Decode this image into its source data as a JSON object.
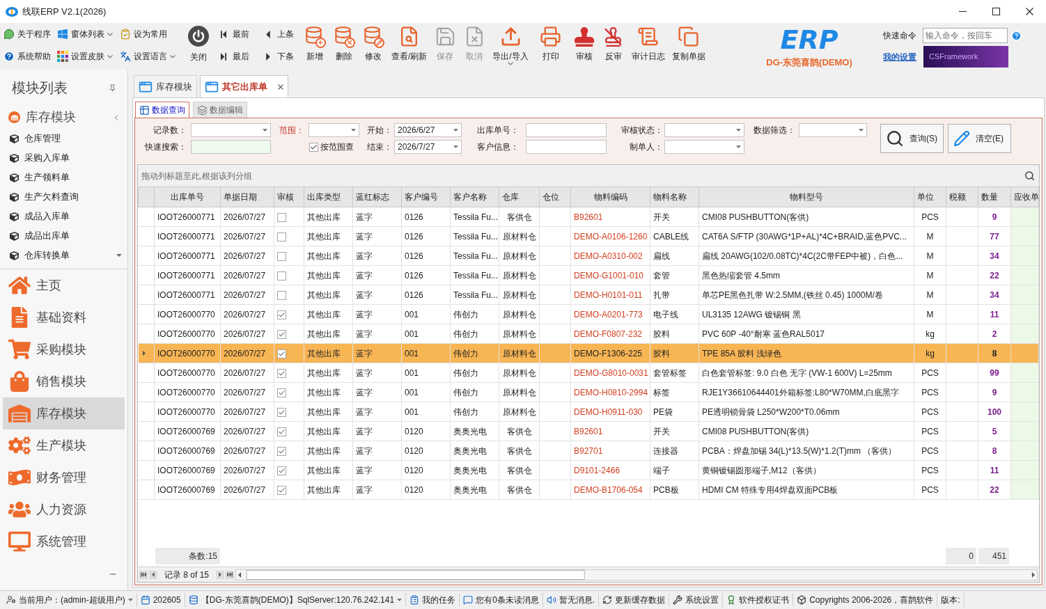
{
  "window": {
    "title": "线联ERP V2.1(2026)"
  },
  "ribbon": {
    "small_buttons": [
      {
        "label": "关于程序",
        "dropdown": false
      },
      {
        "label": "窗体列表",
        "dropdown": true
      },
      {
        "label": "设为常用",
        "dropdown": false
      },
      {
        "label": "系统帮助",
        "dropdown": false
      },
      {
        "label": "设置皮肤",
        "dropdown": true
      },
      {
        "label": "设置语言",
        "dropdown": true
      }
    ],
    "close_button": {
      "label": "关闭"
    },
    "nav_buttons": [
      {
        "label": "最前"
      },
      {
        "label": "上条"
      },
      {
        "label": "最后"
      },
      {
        "label": "下条"
      }
    ],
    "actions": [
      {
        "label": "新增",
        "disabled": false,
        "dropdown": false
      },
      {
        "label": "删除",
        "disabled": false,
        "dropdown": false
      },
      {
        "label": "修改",
        "disabled": false,
        "dropdown": false
      },
      {
        "label": "查看/刷新",
        "disabled": false,
        "dropdown": false
      },
      {
        "label": "保存",
        "disabled": true,
        "dropdown": false
      },
      {
        "label": "取消",
        "disabled": true,
        "dropdown": false
      },
      {
        "label": "导出/导入",
        "disabled": false,
        "dropdown": true
      },
      {
        "label": "打印",
        "disabled": false,
        "dropdown": false
      },
      {
        "label": "审核",
        "disabled": false,
        "dropdown": false
      },
      {
        "label": "反审",
        "disabled": false,
        "dropdown": false
      },
      {
        "label": "审计日志",
        "disabled": false,
        "dropdown": false
      },
      {
        "label": "复制单据",
        "disabled": false,
        "dropdown": false
      }
    ]
  },
  "brand": {
    "logo": "ERP",
    "company": "DG-东莞喜鹊(DEMO)"
  },
  "quick_command": {
    "label": "快速命令",
    "placeholder": "输入命令，按回车"
  },
  "settings_link": "我的设置",
  "banner": "CSFramework",
  "sidebar": {
    "title": "模块列表",
    "group": {
      "label": "库存模块",
      "expanded": true,
      "items": [
        "仓库管理",
        "采购入库单",
        "生产领料单",
        "生产欠料查询",
        "成品入库单",
        "成品出库单",
        "仓库转换单"
      ]
    },
    "modules": [
      {
        "label": "主页",
        "selected": false
      },
      {
        "label": "基础资料",
        "selected": false
      },
      {
        "label": "采购模块",
        "selected": false
      },
      {
        "label": "销售模块",
        "selected": false
      },
      {
        "label": "库存模块",
        "selected": true
      },
      {
        "label": "生产模块",
        "selected": false
      },
      {
        "label": "财务管理",
        "selected": false
      },
      {
        "label": "人力资源",
        "selected": false
      },
      {
        "label": "系统管理",
        "selected": false
      }
    ]
  },
  "doc_tabs": [
    {
      "label": "库存模块",
      "selected": false,
      "closable": false
    },
    {
      "label": "其它出库单",
      "selected": true,
      "closable": true
    }
  ],
  "inner_tabs": [
    {
      "label": "数据查询",
      "selected": true
    },
    {
      "label": "数据编辑",
      "selected": false
    }
  ],
  "filters": {
    "record_count": {
      "label": "记录数："
    },
    "quick_search": {
      "label": "快速搜索："
    },
    "range": {
      "label": "范围："
    },
    "range_check": {
      "label": "按范围查",
      "checked": true
    },
    "start": {
      "label": "开始：",
      "value": "2026/6/27"
    },
    "end": {
      "label": "结束：",
      "value": "2026/7/27"
    },
    "order_no": {
      "label": "出库单号："
    },
    "customer": {
      "label": "客户信息："
    },
    "audit_status": {
      "label": "审核状态："
    },
    "creator": {
      "label": "制单人："
    },
    "data_filter": {
      "label": "数据筛选："
    },
    "buttons": [
      "查询(S)",
      "清空(E)"
    ]
  },
  "grid": {
    "group_hint": "拖动列标题至此,根据该列分组",
    "columns": [
      "出库单号",
      "单据日期",
      "审核",
      "出库类型",
      "蓝红标志",
      "客户编号",
      "客户名称",
      "仓库",
      "仓位",
      "物料编码",
      "物料名称",
      "物料型号",
      "单位",
      "税额",
      "数量",
      "应收单"
    ],
    "rows": [
      {
        "selected": false,
        "order_no": "IOOT26000771",
        "date": "2026/07/27",
        "audited": false,
        "type": "其他出库",
        "flag": "蓝字",
        "customer_no": "0126",
        "customer_name": "Tessila Fu...",
        "warehouse": "客供仓",
        "material_code": "B92601",
        "material_name": "开关",
        "model": "CMI08 PUSHBUTTON(客供)",
        "unit": "PCS",
        "quantity": "9"
      },
      {
        "selected": false,
        "order_no": "IOOT26000771",
        "date": "2026/07/27",
        "audited": false,
        "type": "其他出库",
        "flag": "蓝字",
        "customer_no": "0126",
        "customer_name": "Tessila Fu...",
        "warehouse": "原材料仓",
        "material_code": "DEMO-A0106-1260",
        "material_name": "CABLE线",
        "model": "CAT6A S/FTP (30AWG*1P+AL)*4C+BRAID,蓝色PVC...",
        "unit": "M",
        "quantity": "77"
      },
      {
        "selected": false,
        "order_no": "IOOT26000771",
        "date": "2026/07/27",
        "audited": false,
        "type": "其他出库",
        "flag": "蓝字",
        "customer_no": "0126",
        "customer_name": "Tessila Fu...",
        "warehouse": "原材料仓",
        "material_code": "DEMO-A0310-002",
        "material_name": "扁线",
        "model": "扁线 20AWG(102/0.08TC)*4C(2C带FEP中被)，白色...",
        "unit": "M",
        "quantity": "34"
      },
      {
        "selected": false,
        "order_no": "IOOT26000771",
        "date": "2026/07/27",
        "audited": false,
        "type": "其他出库",
        "flag": "蓝字",
        "customer_no": "0126",
        "customer_name": "Tessila Fu...",
        "warehouse": "原材料仓",
        "material_code": "DEMO-G1001-010",
        "material_name": "套管",
        "model": "黑色热缩套管 4.5mm",
        "unit": "M",
        "quantity": "22"
      },
      {
        "selected": false,
        "order_no": "IOOT26000771",
        "date": "2026/07/27",
        "audited": false,
        "type": "其他出库",
        "flag": "蓝字",
        "customer_no": "0126",
        "customer_name": "Tessila Fu...",
        "warehouse": "原材料仓",
        "material_code": "DEMO-H0101-011",
        "material_name": "扎带",
        "model": "单芯PE黑色扎带 W:2.5MM,(铁丝 0.45) 1000M/卷",
        "unit": "M",
        "quantity": "34"
      },
      {
        "selected": false,
        "order_no": "IOOT26000770",
        "date": "2026/07/27",
        "audited": true,
        "type": "其他出库",
        "flag": "蓝字",
        "customer_no": "001",
        "customer_name": "伟创力",
        "warehouse": "原材料仓",
        "material_code": "DEMO-A0201-773",
        "material_name": "电子线",
        "model": "UL3135 12AWG 镀锡铜 黑",
        "unit": "M",
        "quantity": "11"
      },
      {
        "selected": false,
        "order_no": "IOOT26000770",
        "date": "2026/07/27",
        "audited": true,
        "type": "其他出库",
        "flag": "蓝字",
        "customer_no": "001",
        "customer_name": "伟创力",
        "warehouse": "原材料仓",
        "material_code": "DEMO-F0807-232",
        "material_name": "胶料",
        "model": "PVC 60P -40°耐寒 蓝色RAL5017",
        "unit": "kg",
        "quantity": "2"
      },
      {
        "selected": true,
        "order_no": "IOOT26000770",
        "date": "2026/07/27",
        "audited": true,
        "type": "其他出库",
        "flag": "蓝字",
        "customer_no": "001",
        "customer_name": "伟创力",
        "warehouse": "原材料仓",
        "material_code": "DEMO-F1306-225",
        "material_name": "胶料",
        "model": "TPE 85A 胶料 浅绿色",
        "unit": "kg",
        "quantity": "8"
      },
      {
        "selected": false,
        "order_no": "IOOT26000770",
        "date": "2026/07/27",
        "audited": true,
        "type": "其他出库",
        "flag": "蓝字",
        "customer_no": "001",
        "customer_name": "伟创力",
        "warehouse": "原材料仓",
        "material_code": "DEMO-G8010-0031",
        "material_name": "套管标签",
        "model": "白色套管标签: 9.0 白色 无字 (VW-1 600V) L=25mm",
        "unit": "PCS",
        "quantity": "99"
      },
      {
        "selected": false,
        "order_no": "IOOT26000770",
        "date": "2026/07/27",
        "audited": true,
        "type": "其他出库",
        "flag": "蓝字",
        "customer_no": "001",
        "customer_name": "伟创力",
        "warehouse": "原材料仓",
        "material_code": "DEMO-H0810-2994",
        "material_name": "标签",
        "model": "RJE1Y36610644401外箱标签:L80*W70MM,白底黑字",
        "unit": "PCS",
        "quantity": "9"
      },
      {
        "selected": false,
        "order_no": "IOOT26000770",
        "date": "2026/07/27",
        "audited": true,
        "type": "其他出库",
        "flag": "蓝字",
        "customer_no": "001",
        "customer_name": "伟创力",
        "warehouse": "原材料仓",
        "material_code": "DEMO-H0911-030",
        "material_name": "PE袋",
        "model": "PE透明锁骨袋 L250*W200*T0.06mm",
        "unit": "PCS",
        "quantity": "100"
      },
      {
        "selected": false,
        "order_no": "IOOT26000769",
        "date": "2026/07/27",
        "audited": true,
        "type": "其他出库",
        "flag": "蓝字",
        "customer_no": "0120",
        "customer_name": "奥奥光电",
        "warehouse": "客供仓",
        "material_code": "B92601",
        "material_name": "开关",
        "model": "CMI08 PUSHBUTTON(客供)",
        "unit": "PCS",
        "quantity": "5"
      },
      {
        "selected": false,
        "order_no": "IOOT26000769",
        "date": "2026/07/27",
        "audited": true,
        "type": "其他出库",
        "flag": "蓝字",
        "customer_no": "0120",
        "customer_name": "奥奥光电",
        "warehouse": "客供仓",
        "material_code": "B92701",
        "material_name": "连接器",
        "model": "PCBA：焊盘加锡 34(L)*13.5(W)*1.2(T)mm （客供）",
        "unit": "PCS",
        "quantity": "8"
      },
      {
        "selected": false,
        "order_no": "IOOT26000769",
        "date": "2026/07/27",
        "audited": true,
        "type": "其他出库",
        "flag": "蓝字",
        "customer_no": "0120",
        "customer_name": "奥奥光电",
        "warehouse": "客供仓",
        "material_code": "D9101-2466",
        "material_name": "端子",
        "model": "黄铜镀锡圆形端子,M12（客供）",
        "unit": "PCS",
        "quantity": "11"
      },
      {
        "selected": false,
        "order_no": "IOOT26000769",
        "date": "2026/07/27",
        "audited": true,
        "type": "其他出库",
        "flag": "蓝字",
        "customer_no": "0120",
        "customer_name": "奥奥光电",
        "warehouse": "客供仓",
        "material_code": "DEMO-B1706-054",
        "material_name": "PCB板",
        "model": "HDMI CM 特殊专用4焊盘双面PCB板",
        "unit": "PCS",
        "quantity": "22"
      }
    ],
    "footer": {
      "count": "条数:15",
      "tax_total": "0",
      "quantity_total": "451"
    },
    "navigator": {
      "record": "记录 8 of 15"
    }
  },
  "status_bar": [
    {
      "text": "当前用户：(admin-超级用户)",
      "dropdown": true
    },
    {
      "text": "202605",
      "dropdown": false
    },
    {
      "text": "【DG-东莞喜鹊(DEMO)】SqlServer:120.76.242.141",
      "dropdown": true
    },
    {
      "text": "我的任务",
      "dropdown": false
    },
    {
      "text": "您有0条未读消息",
      "dropdown": false
    },
    {
      "text": "暂无消息.",
      "dropdown": false
    },
    {
      "text": "更新缓存数据",
      "dropdown": false
    },
    {
      "text": "系统设置",
      "dropdown": false
    },
    {
      "text": "软件授权证书",
      "dropdown": false
    },
    {
      "text": "Copyrights 2006-2026，喜鹊软件",
      "dropdown": false
    },
    {
      "text": "版本:",
      "dropdown": false
    }
  ]
}
